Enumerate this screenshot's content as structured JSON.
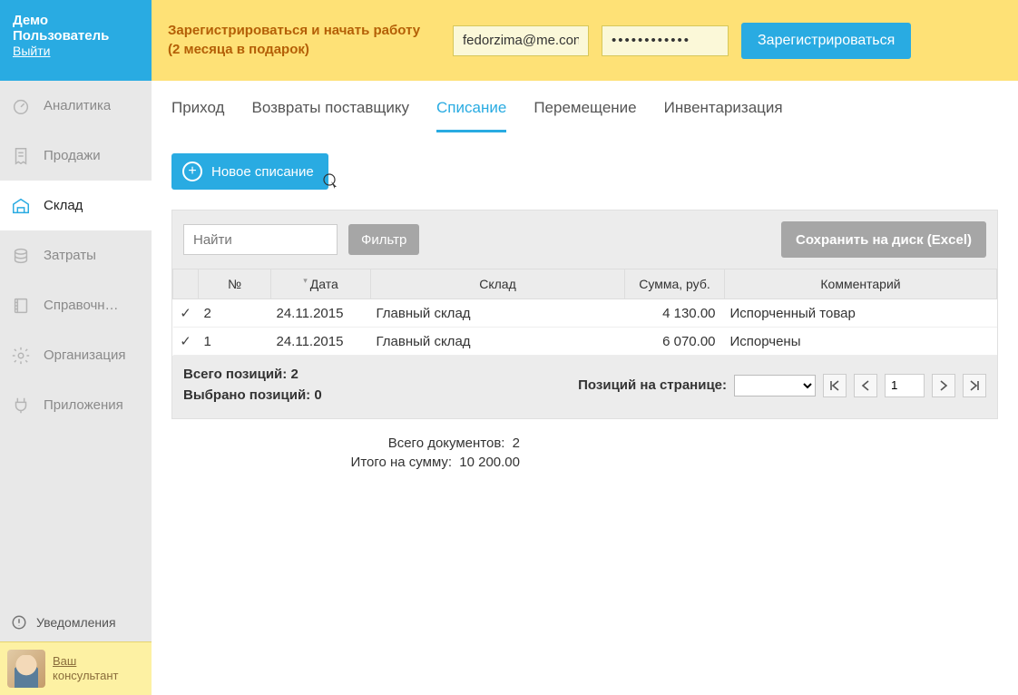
{
  "sidebar": {
    "username": "Демо Пользователь",
    "logout": "Выйти",
    "items": [
      {
        "label": "Аналитика",
        "icon": "gauge"
      },
      {
        "label": "Продажи",
        "icon": "receipt"
      },
      {
        "label": "Склад",
        "icon": "warehouse"
      },
      {
        "label": "Затраты",
        "icon": "coins"
      },
      {
        "label": "Справочн…",
        "icon": "book"
      },
      {
        "label": "Организация",
        "icon": "gear"
      },
      {
        "label": "Приложения",
        "icon": "plug"
      }
    ],
    "activeIndex": 2,
    "notifications": "Уведомления",
    "consultant": {
      "line1": "Ваш",
      "line2": "консультант"
    }
  },
  "banner": {
    "message_l1": "Зарегистрироваться и начать работу",
    "message_l2": "(2 месяца в подарок)",
    "email": "fedorzima@me.con",
    "password": "••••••••••••",
    "button": "Зарегистрироваться"
  },
  "tabs": {
    "items": [
      "Приход",
      "Возвраты поставщику",
      "Списание",
      "Перемещение",
      "Инвентаризация"
    ],
    "activeIndex": 2
  },
  "toolbar": {
    "new_btn": "Новое списание",
    "search_placeholder": "Найти",
    "filter_btn": "Фильтр",
    "excel_btn": "Сохранить на диск (Excel)"
  },
  "table": {
    "headers": {
      "num": "№",
      "date": "Дата",
      "warehouse": "Склад",
      "sum": "Сумма, руб.",
      "comment": "Комментарий"
    },
    "rows": [
      {
        "checked": true,
        "num": "2",
        "date": "24.11.2015",
        "warehouse": "Главный склад",
        "sum": "4 130.00",
        "comment": "Испорченный товар"
      },
      {
        "checked": true,
        "num": "1",
        "date": "24.11.2015",
        "warehouse": "Главный склад",
        "sum": "6 070.00",
        "comment": "Испорчены"
      }
    ]
  },
  "footer": {
    "total_positions_label": "Всего позиций:",
    "total_positions": "2",
    "selected_positions_label": "Выбрано позиций:",
    "selected_positions": "0",
    "per_page_label": "Позиций на странице:",
    "page": "1"
  },
  "summary": {
    "docs_label": "Всего документов:",
    "docs_value": "2",
    "sum_label": "Итого на сумму:",
    "sum_value": "10 200.00"
  }
}
